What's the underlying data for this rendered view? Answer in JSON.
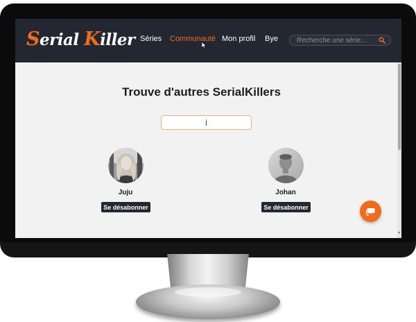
{
  "app": {
    "logo": {
      "first": "Serial",
      "second": "Killer"
    },
    "colors": {
      "accent": "#ef6c1a",
      "navbar": "#232731",
      "background": "#f2f2f2"
    }
  },
  "nav": {
    "items": [
      {
        "label": "Séries",
        "active": false
      },
      {
        "label": "Communauté",
        "active": true
      },
      {
        "label": "Mon profil",
        "active": false
      },
      {
        "label": "Bye",
        "active": false
      }
    ],
    "search": {
      "placeholder": "Recherche une série...",
      "icon": "search-icon"
    }
  },
  "main": {
    "title": "Trouve d'autres SerialKillers",
    "user_search": {
      "value": "j"
    },
    "users": [
      {
        "name": "Juju",
        "button_label": "Se désabonner",
        "avatar": "avatar-woman"
      },
      {
        "name": "Johan",
        "button_label": "Se désabonner",
        "avatar": "avatar-man"
      }
    ],
    "chat_button": {
      "icon": "chat-bubble-icon"
    }
  }
}
